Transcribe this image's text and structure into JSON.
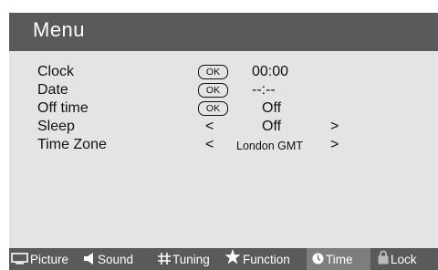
{
  "menu": {
    "title": "Menu",
    "ok_label": "OK",
    "prev_arrow": "<",
    "next_arrow": ">",
    "rows": [
      {
        "label": "Clock",
        "value": "00:00"
      },
      {
        "label": "Date",
        "value": "--:--"
      },
      {
        "label": "Off time",
        "value": "Off"
      },
      {
        "label": "Sleep",
        "value": "Off"
      },
      {
        "label": "Time Zone",
        "value": "London GMT"
      }
    ]
  },
  "tabs": [
    {
      "label": "Picture",
      "icon": "tv-icon"
    },
    {
      "label": "Sound",
      "icon": "speaker-icon"
    },
    {
      "label": "Tuning",
      "icon": "grid-icon"
    },
    {
      "label": "Function",
      "icon": "star-icon"
    },
    {
      "label": "Time",
      "icon": "clock-icon",
      "active": true
    },
    {
      "label": "Lock",
      "icon": "lock-icon"
    }
  ],
  "colors": {
    "panel_background": "#e4e4e4",
    "bar_background": "#5a5a5a",
    "active_tab": "#7e7e7e",
    "text": "#111111"
  }
}
